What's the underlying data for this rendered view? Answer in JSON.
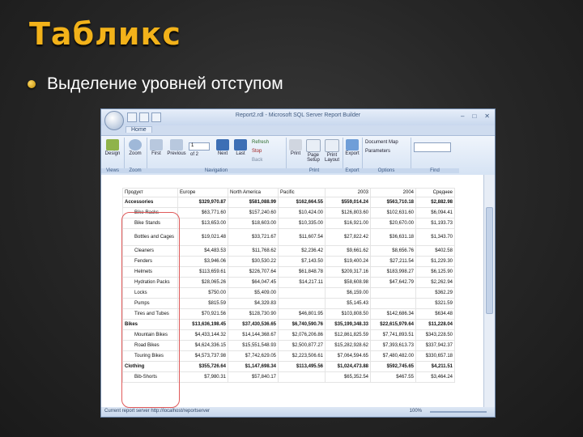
{
  "slide": {
    "title": "Табликс",
    "bullet": "Выделение уровней отступом"
  },
  "window": {
    "title": "Report2.rdl - Microsoft SQL Server Report Builder",
    "tab": "Home",
    "ribbon": {
      "view_group": "Views",
      "zoom_group": "Zoom",
      "navigation_group": "Navigation",
      "print_group": "Print",
      "export_group": "Export",
      "options_group": "Options",
      "find_group": "Find",
      "design": "Design",
      "zoom": "Zoom",
      "first": "First",
      "previous": "Previous",
      "page": "1",
      "of": "of 2",
      "next": "Next",
      "last": "Last",
      "refresh": "Refresh",
      "stop": "Stop",
      "back": "Back",
      "print": "Print",
      "page_setup": "Page Setup",
      "print_layout": "Print Layout",
      "export": "Export",
      "document_map": "Document Map",
      "parameters": "Parameters"
    },
    "status": "Current report server http://localhost/reportserver",
    "zoom_level": "100%"
  },
  "table": {
    "headers": [
      "Продукт",
      "Europe",
      "North America",
      "Pacific",
      "2003",
      "2004",
      "Среднее"
    ],
    "rows": [
      {
        "name": "Accessories",
        "level": 0,
        "values": [
          "$329,970.87",
          "$581,088.99",
          "$162,664.55",
          "$559,014.24",
          "$563,710.18",
          "$2,882.98"
        ]
      },
      {
        "name": "Bike Racks",
        "level": 1,
        "values": [
          "$63,771.60",
          "$157,240.60",
          "$10,424.00",
          "$126,803.60",
          "$102,631.60",
          "$6,094.41"
        ]
      },
      {
        "name": "Bike Stands",
        "level": 1,
        "values": [
          "$13,653.00",
          "$18,603.00",
          "$10,335.00",
          "$16,921.00",
          "$20,670.00",
          "$1,193.73"
        ]
      },
      {
        "name": "Bottles and Cages",
        "level": 1,
        "tall": true,
        "values": [
          "$19,021.48",
          "$33,721.67",
          "$11,607.54",
          "$27,822.42",
          "$36,631.18",
          "$1,343.70"
        ]
      },
      {
        "name": "Cleaners",
        "level": 1,
        "values": [
          "$4,483.53",
          "$11,768.62",
          "$2,236.42",
          "$9,661.62",
          "$8,656.76",
          "$402.58"
        ]
      },
      {
        "name": "Fenders",
        "level": 1,
        "values": [
          "$3,946.06",
          "$30,530.22",
          "$7,143.50",
          "$19,400.24",
          "$27,211.54",
          "$1,229.30"
        ]
      },
      {
        "name": "Helmets",
        "level": 1,
        "values": [
          "$113,659.61",
          "$226,707.64",
          "$61,848.78",
          "$209,317.16",
          "$183,998.27",
          "$6,125.90"
        ]
      },
      {
        "name": "Hydration Packs",
        "level": 1,
        "values": [
          "$28,065.26",
          "$64,047.45",
          "$14,217.11",
          "$58,608.98",
          "$47,642.79",
          "$2,262.94"
        ]
      },
      {
        "name": "Locks",
        "level": 1,
        "values": [
          "$750.00",
          "$5,409.00",
          "",
          "$6,159.00",
          "",
          "$362.29"
        ]
      },
      {
        "name": "Pumps",
        "level": 1,
        "values": [
          "$815.59",
          "$4,329.83",
          "",
          "$5,145.43",
          "",
          "$321.59"
        ]
      },
      {
        "name": "Tires and Tubes",
        "level": 1,
        "values": [
          "$70,921.56",
          "$128,730.90",
          "$46,801.95",
          "$103,808.50",
          "$142,686.34",
          "$634.48"
        ]
      },
      {
        "name": "Bikes",
        "level": 0,
        "values": [
          "$13,636,198.45",
          "$37,430,536.65",
          "$6,740,590.76",
          "$35,199,348.33",
          "$22,615,979.64",
          "$11,228.04"
        ]
      },
      {
        "name": "Mountain Bikes",
        "level": 1,
        "values": [
          "$4,433,144.32",
          "$14,144,368.67",
          "$2,076,206.86",
          "$12,861,825.59",
          "$7,741,893.51",
          "$343,228.50"
        ]
      },
      {
        "name": "Road Bikes",
        "level": 1,
        "values": [
          "$4,624,336.15",
          "$15,551,548.93",
          "$2,500,877.27",
          "$15,282,928.62",
          "$7,393,613.73",
          "$337,942.37"
        ]
      },
      {
        "name": "Touring Bikes",
        "level": 1,
        "values": [
          "$4,573,737.98",
          "$7,742,629.05",
          "$2,223,506.61",
          "$7,064,594.65",
          "$7,480,482.00",
          "$330,657.18"
        ]
      },
      {
        "name": "Clothing",
        "level": 0,
        "values": [
          "$355,726.64",
          "$1,147,698.34",
          "$113,495.56",
          "$1,024,473.88",
          "$592,745.65",
          "$4,211.51"
        ]
      },
      {
        "name": "Bib-Shorts",
        "level": 1,
        "values": [
          "$7,980.31",
          "$57,840.17",
          "",
          "$65,352.54",
          "$467.55",
          "$3,464.24"
        ]
      }
    ]
  }
}
